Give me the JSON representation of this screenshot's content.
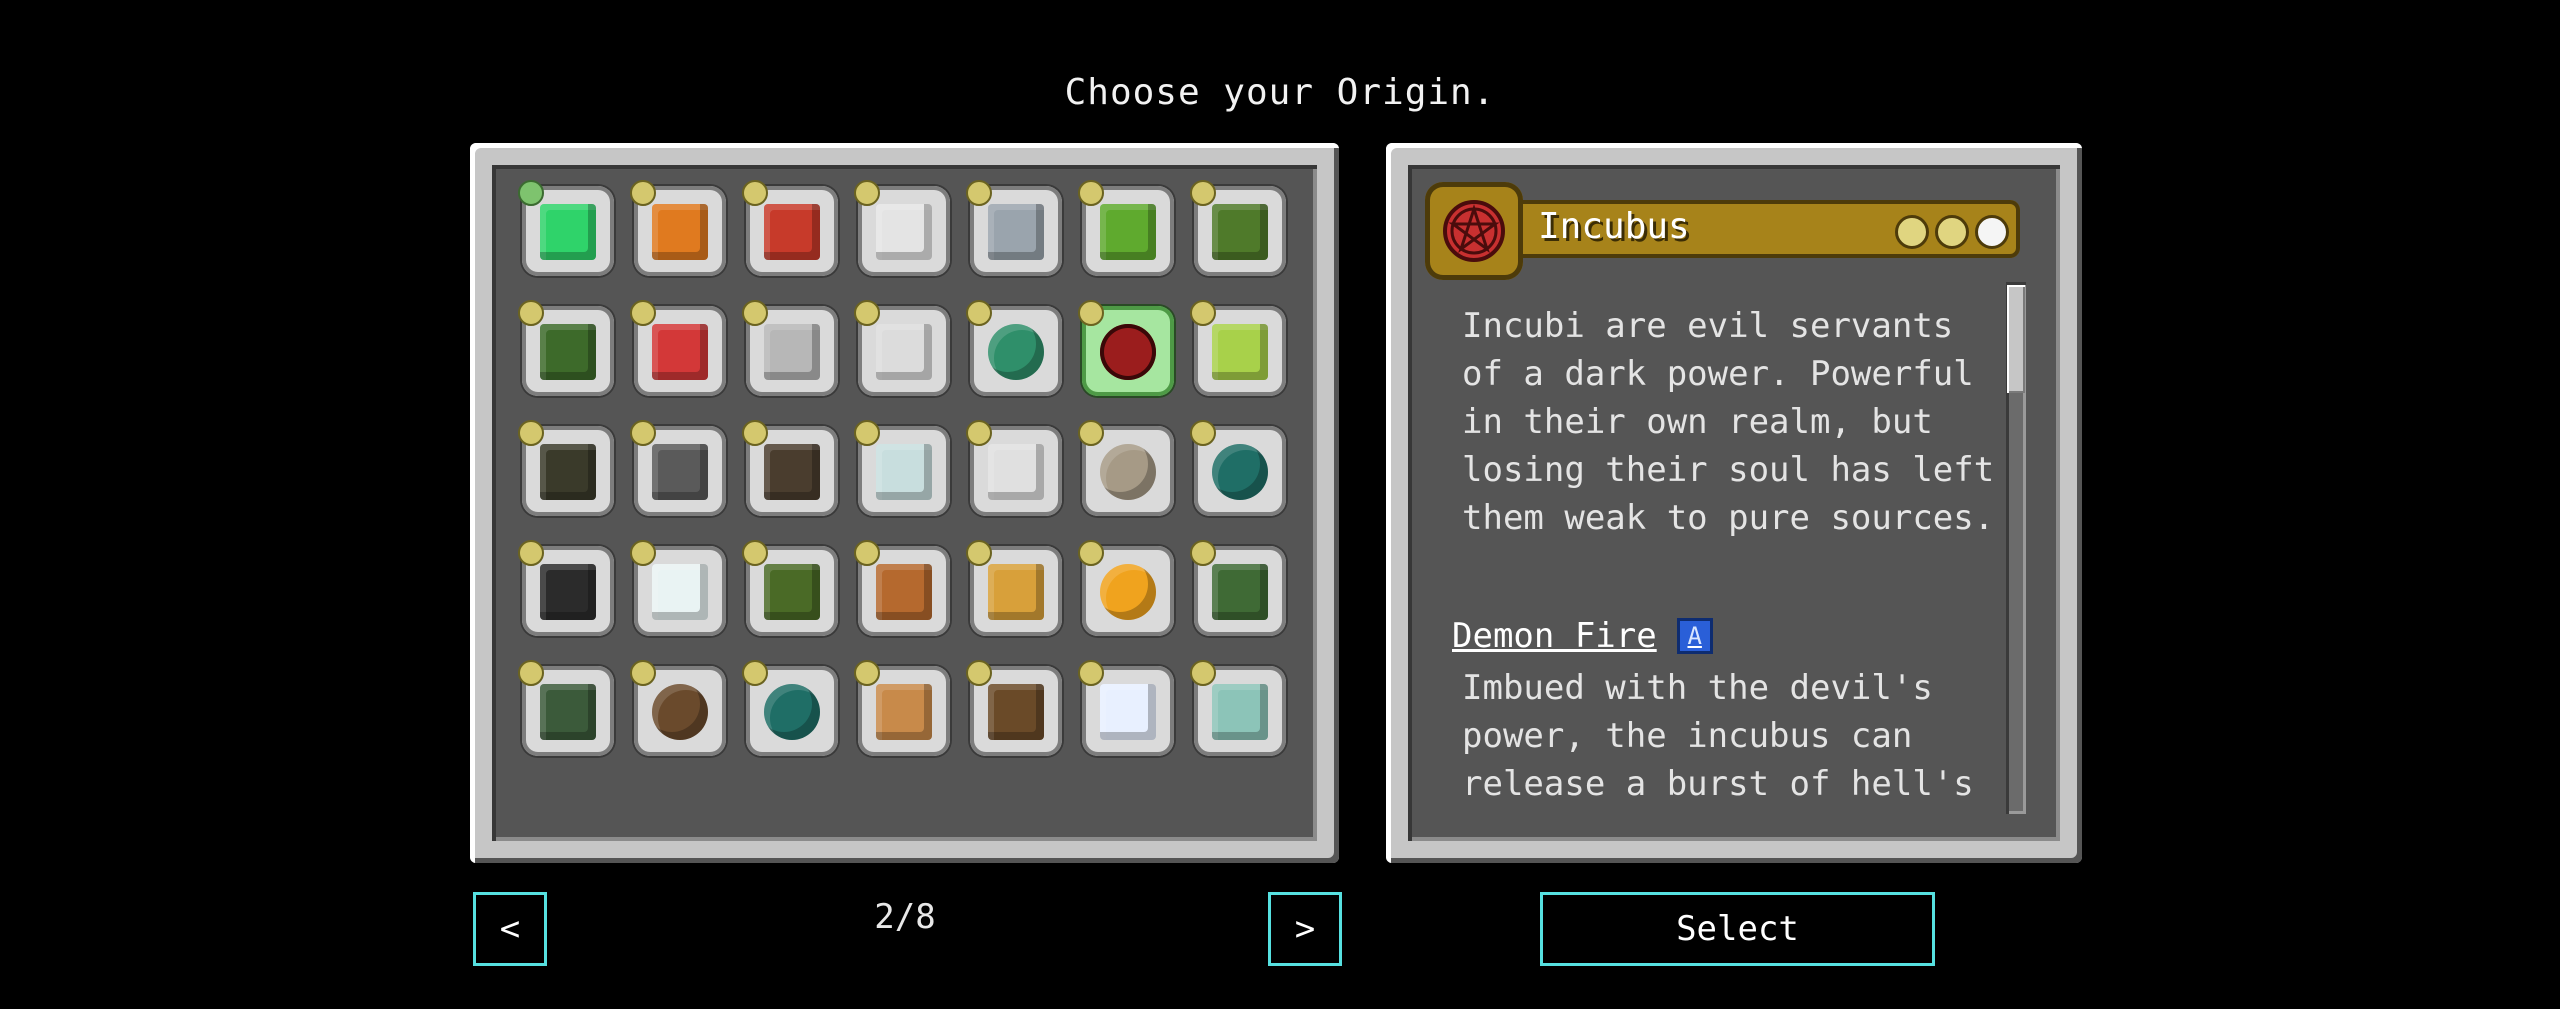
{
  "screen": {
    "title": "Choose your Origin."
  },
  "origins": [
    {
      "icon": "emerald-icon",
      "color": "#2fd36a",
      "impact": "green"
    },
    {
      "icon": "orange-block-icon",
      "color": "#e07a1f",
      "impact": "yellow"
    },
    {
      "icon": "tnt-icon",
      "color": "#c73a2a",
      "impact": "yellow"
    },
    {
      "icon": "glass-pane-icon",
      "color": "#e4e4e4",
      "impact": "yellow"
    },
    {
      "icon": "water-bucket-icon",
      "color": "#9aa4ad",
      "impact": "yellow"
    },
    {
      "icon": "slime-block-icon",
      "color": "#5faa2e",
      "impact": "yellow"
    },
    {
      "icon": "hay-block-icon",
      "color": "#4f7a2a",
      "impact": "yellow"
    },
    {
      "icon": "azalea-bush-icon",
      "color": "#3d6a2a",
      "impact": "yellow"
    },
    {
      "icon": "red-mushroom-icon",
      "color": "#d33838",
      "impact": "yellow"
    },
    {
      "icon": "iron-block-icon",
      "color": "#b7b7b7",
      "impact": "yellow"
    },
    {
      "icon": "cobweb-icon",
      "color": "#dcdcdc",
      "impact": "yellow"
    },
    {
      "icon": "ender-eye-icon",
      "color": "#2f8f6a",
      "impact": "yellow"
    },
    {
      "icon": "pentagram-icon",
      "color": "#9b1d1d",
      "impact": "yellow"
    },
    {
      "icon": "potion-bottle-icon",
      "color": "#a8d14a",
      "impact": "yellow"
    },
    {
      "icon": "sapling-icon",
      "color": "#3a3a2a",
      "impact": "yellow"
    },
    {
      "icon": "furnace-icon",
      "color": "#5a5a5a",
      "impact": "yellow"
    },
    {
      "icon": "soul-soil-icon",
      "color": "#4a3d2e",
      "impact": "yellow"
    },
    {
      "icon": "glass-block-icon",
      "color": "#c8dede",
      "impact": "yellow"
    },
    {
      "icon": "snow-golem-icon",
      "color": "#e0e0e0",
      "impact": "yellow"
    },
    {
      "icon": "turtle-egg-icon",
      "color": "#a69a86",
      "impact": "yellow"
    },
    {
      "icon": "ender-pearl-icon",
      "color": "#1f6e66",
      "impact": "yellow"
    },
    {
      "icon": "blackstone-icon",
      "color": "#2b2b2b",
      "impact": "yellow"
    },
    {
      "icon": "ghast-tear-icon",
      "color": "#e9f3f3",
      "impact": "yellow"
    },
    {
      "icon": "moss-block-icon",
      "color": "#4a6a26",
      "impact": "yellow"
    },
    {
      "icon": "lightning-rod-icon",
      "color": "#b5692e",
      "impact": "yellow"
    },
    {
      "icon": "totem-icon",
      "color": "#d8a03a",
      "impact": "yellow"
    },
    {
      "icon": "honeycomb-icon",
      "color": "#f0a31e",
      "impact": "yellow"
    },
    {
      "icon": "vine-icon",
      "color": "#3f6a35",
      "impact": "yellow"
    },
    {
      "icon": "zombie-head-icon",
      "color": "#3b5a3a",
      "impact": "yellow"
    },
    {
      "icon": "cocoa-bean-icon",
      "color": "#6a4a2c",
      "impact": "yellow"
    },
    {
      "icon": "ender-pearl-icon",
      "color": "#1f6e66",
      "impact": "yellow"
    },
    {
      "icon": "bread-icon",
      "color": "#c88a4a",
      "impact": "yellow"
    },
    {
      "icon": "wooden-sword-icon",
      "color": "#6a4a28",
      "impact": "yellow"
    },
    {
      "icon": "nether-star-icon",
      "color": "#e8f0ff",
      "impact": "yellow"
    },
    {
      "icon": "trident-icon",
      "color": "#8cc4b8",
      "impact": "yellow"
    }
  ],
  "selected_index": 12,
  "detail": {
    "name": "Incubus",
    "impact_level": 2,
    "description": "Incubi are evil servants of a dark power. Powerful in their own realm, but losing their soul has left them weak to pure sources.",
    "power_name": "Demon Fire",
    "power_badge": "A",
    "power_description": "Imbued with the devil's power, the incubus can release a burst of hell's"
  },
  "pagination": {
    "page_text": "2/8",
    "prev": "<",
    "next": ">"
  },
  "select_label": "Select",
  "colors": {
    "accent": "#56e0e0",
    "header_gold": "#a7831a",
    "selected_tile": "#a6e6a0"
  }
}
